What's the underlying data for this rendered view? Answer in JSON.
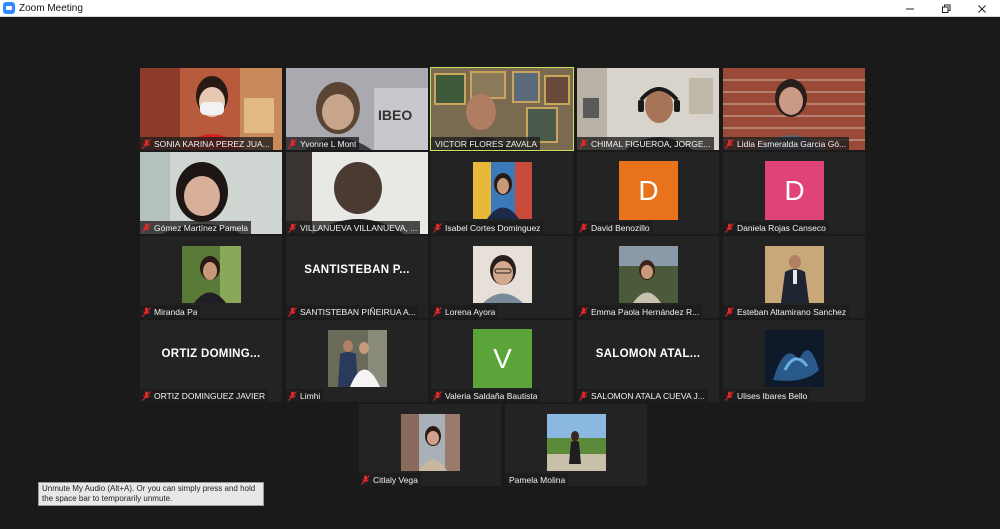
{
  "window": {
    "title": "Zoom Meeting",
    "controls": [
      "minimize",
      "maximize",
      "close"
    ]
  },
  "participants": [
    {
      "name": "SONIA KARINA PEREZ JUA...",
      "kind": "video",
      "muted": true
    },
    {
      "name": "Yvonne L Mont",
      "kind": "video",
      "muted": true
    },
    {
      "name": "VICTOR FLORES ZAVALA",
      "kind": "video",
      "muted": true,
      "active_speaker": true
    },
    {
      "name": "CHIMAL FIGUEROA, JORGE...",
      "kind": "video",
      "muted": true
    },
    {
      "name": "Lidia Esmeralda Garcia Gó...",
      "kind": "video",
      "muted": true
    },
    {
      "name": "Gómez Martínez Pamela",
      "kind": "video",
      "muted": true
    },
    {
      "name": "VILLANUEVA VILLANUEVA, ...",
      "kind": "video",
      "muted": true
    },
    {
      "name": "Isabel Cortes Dominguez",
      "kind": "photo",
      "muted": true
    },
    {
      "name": "David Benozillo",
      "kind": "avatar",
      "letter": "D",
      "color": "#e8731c",
      "muted": true
    },
    {
      "name": "Daniela Rojas Canseco",
      "kind": "avatar",
      "letter": "D",
      "color": "#e0427a",
      "muted": true
    },
    {
      "name": "Miranda Pa",
      "kind": "photo",
      "muted": true
    },
    {
      "name": "SANTISTEBAN PIÑEIRUA A...",
      "kind": "text",
      "display": "SANTISTEBAN P...",
      "muted": true
    },
    {
      "name": "Lorena Ayora",
      "kind": "photo",
      "muted": true
    },
    {
      "name": "Emma Paola Hernández R...",
      "kind": "photo",
      "muted": true
    },
    {
      "name": "Esteban Altamirano Sanchez",
      "kind": "photo",
      "muted": true
    },
    {
      "name": "ORTIZ DOMINGUEZ JAVIER",
      "kind": "text",
      "display": "ORTIZ DOMING...",
      "muted": true
    },
    {
      "name": "Limhi",
      "kind": "photo",
      "muted": true
    },
    {
      "name": "Valeria Saldaña Bautista",
      "kind": "avatar",
      "letter": "V",
      "color": "#5ba43a",
      "muted": true
    },
    {
      "name": "SALOMON ATALA CUEVA J...",
      "kind": "text",
      "display": "SALOMON ATAL...",
      "muted": true
    },
    {
      "name": "Ulises Ibares Bello",
      "kind": "photo",
      "muted": true
    },
    {
      "name": "Citlaly Vega",
      "kind": "photo",
      "muted": true
    },
    {
      "name": "Pamela Molina",
      "kind": "photo",
      "muted": false
    }
  ],
  "tooltip": {
    "text": "Unmute My Audio (Alt+A). Or you can simply press and hold the space bar to temporarily unmute."
  },
  "colors": {
    "active_speaker_border": "#c9e265",
    "background": "#1a1a1a",
    "mute_icon": "#e02828"
  }
}
